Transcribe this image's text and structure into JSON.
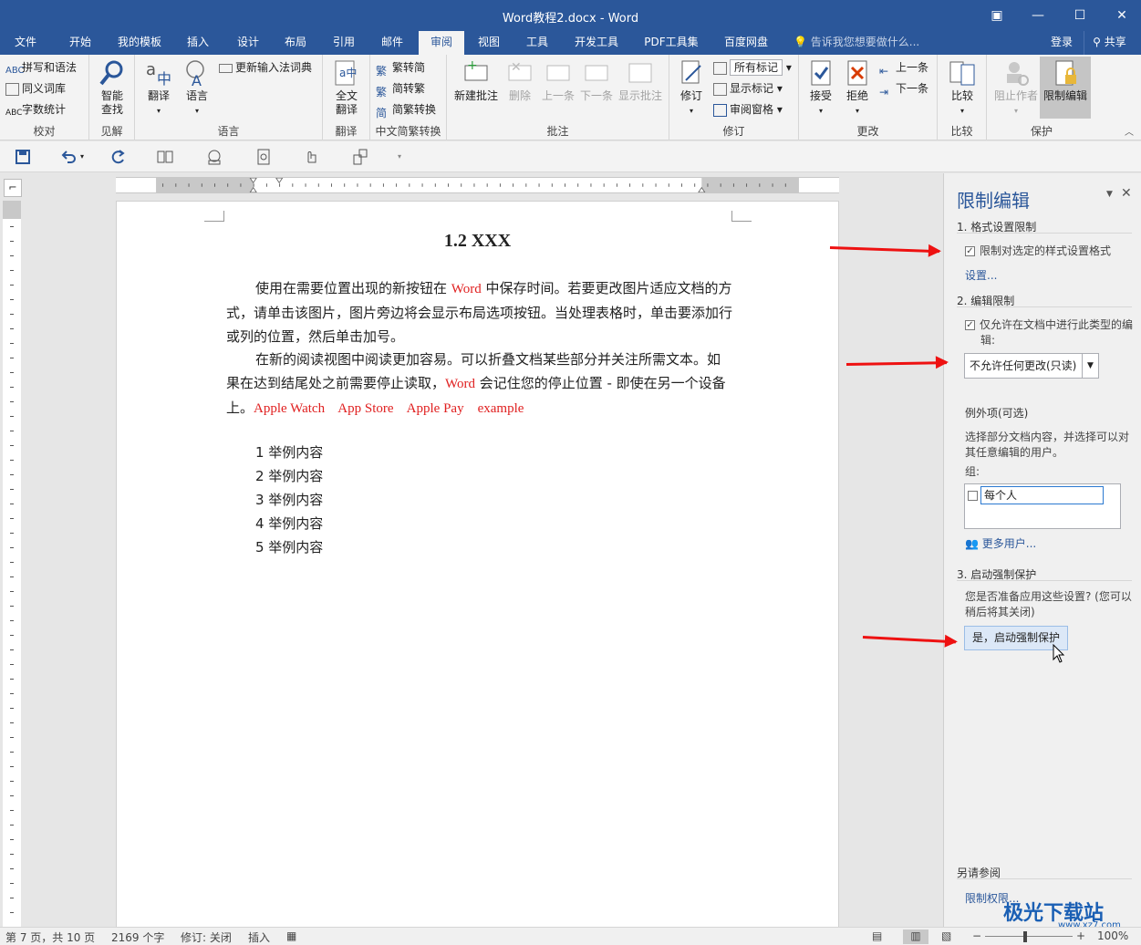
{
  "window": {
    "title": "Word教程2.docx - Word"
  },
  "tabs": [
    {
      "label": "文件"
    },
    {
      "label": "开始"
    },
    {
      "label": "我的模板"
    },
    {
      "label": "插入"
    },
    {
      "label": "设计"
    },
    {
      "label": "布局"
    },
    {
      "label": "引用"
    },
    {
      "label": "邮件"
    },
    {
      "label": "审阅"
    },
    {
      "label": "视图"
    },
    {
      "label": "工具"
    },
    {
      "label": "开发工具"
    },
    {
      "label": "PDF工具集"
    },
    {
      "label": "百度网盘"
    }
  ],
  "tell_me": "告诉我您想要做什么...",
  "login": "登录",
  "share": "共享",
  "ribbon": {
    "proofing": {
      "spell": "拼写和语法",
      "thesaurus": "同义词库",
      "wordcount": "字数统计",
      "name": "校对"
    },
    "insights": {
      "smart_lookup": "智能\n查找",
      "name": "见解"
    },
    "language": {
      "translate": "翻译",
      "language": "语言",
      "update_ime": "更新输入法词典",
      "name": "语言"
    },
    "translation": {
      "full_translate": "全文\n翻译",
      "name": "翻译"
    },
    "chinese": {
      "to_simplified": "繁转简",
      "to_traditional": "简转繁",
      "convert": "简繁转换",
      "name": "中文简繁转换"
    },
    "comments": {
      "new": "新建批注",
      "delete": "删除",
      "prev": "上一条",
      "next": "下一条",
      "show": "显示批注",
      "name": "批注"
    },
    "tracking": {
      "track": "修订",
      "markup": "所有标记",
      "show_markup": "显示标记",
      "pane": "审阅窗格",
      "name": "修订"
    },
    "changes": {
      "accept": "接受",
      "reject": "拒绝",
      "prev": "上一条",
      "next": "下一条",
      "name": "更改"
    },
    "compare": {
      "compare": "比较",
      "name": "比较"
    },
    "protect": {
      "block": "阻止作者",
      "restrict": "限制编辑",
      "name": "保护"
    }
  },
  "document": {
    "title": "1.2 XXX",
    "p1_a": "使用在需要位置出现的新按钮在 ",
    "p1_word": "Word",
    "p1_b": " 中保存时间。若要更改图片适应文档的方式，请单击该图片，图片旁边将会显示布局选项按钮。当处理表格时，单击要添加行或列的位置，然后单击加号。",
    "p2_a": "在新的阅读视图中阅读更加容易。可以折叠文档某些部分并关注所需文本。如果在达到结尾处之前需要停止读取，",
    "p2_word": "Word",
    "p2_b": " 会记住您的停止位置 - 即使在另一个设备上。",
    "p2_red": "Apple Watch    App Store    Apple Pay    example",
    "list": [
      "1 举例内容",
      "2 举例内容",
      "3 举例内容",
      "4 举例内容",
      "5 举例内容"
    ]
  },
  "pane": {
    "title": "限制编辑",
    "s1": "1. 格式设置限制",
    "s1_check": "限制对选定的样式设置格式",
    "s1_settings": "设置...",
    "s2": "2. 编辑限制",
    "s2_check": "仅允许在文档中进行此类型的编辑:",
    "s2_select": "不允许任何更改(只读)",
    "exceptions": "例外项(可选)",
    "exceptions_desc": "选择部分文档内容，并选择可以对其任意编辑的用户。",
    "groups": "组:",
    "everyone": "每个人",
    "more_users": "更多用户...",
    "s3": "3. 启动强制保护",
    "s3_desc": "您是否准备应用这些设置? (您可以稍后将其关闭)",
    "yes_button": "是，启动强制保护",
    "see_also": "另请参阅",
    "permissions": "限制权限..."
  },
  "status": {
    "page": "第 7 页，共 10 页",
    "words": "2169 个字",
    "track": "修订: 关闭",
    "insert": "插入",
    "zoom": "100%"
  },
  "watermark": {
    "text": "极光下载站",
    "url": "www.xz7.com"
  },
  "colors": {
    "accent": "#2b579a",
    "red": "#e02020"
  }
}
